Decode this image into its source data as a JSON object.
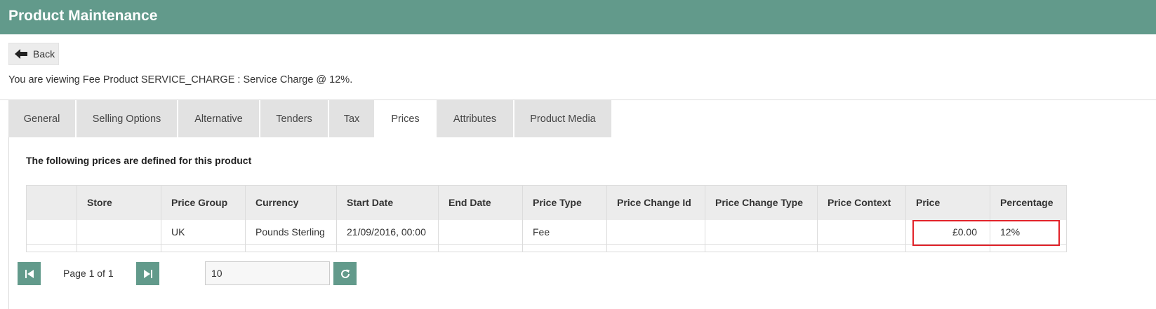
{
  "header": {
    "title": "Product Maintenance"
  },
  "back_button": {
    "label": "Back"
  },
  "viewing_text": "You are viewing Fee Product SERVICE_CHARGE : Service Charge @ 12%.",
  "tabs": [
    {
      "label": "General",
      "active": false
    },
    {
      "label": "Selling Options",
      "active": false
    },
    {
      "label": "Alternative",
      "active": false
    },
    {
      "label": "Tenders",
      "active": false
    },
    {
      "label": "Tax",
      "active": false
    },
    {
      "label": "Prices",
      "active": true
    },
    {
      "label": "Attributes",
      "active": false
    },
    {
      "label": "Product Media",
      "active": false
    }
  ],
  "prices": {
    "title": "The following prices are defined for this product",
    "columns": [
      "",
      "Store",
      "Price Group",
      "Currency",
      "Start Date",
      "End Date",
      "Price Type",
      "Price Change Id",
      "Price Change Type",
      "Price Context",
      "Price",
      "Percentage"
    ],
    "rows": [
      [
        "",
        "",
        "UK",
        "Pounds Sterling",
        "21/09/2016, 00:00",
        "",
        "Fee",
        "",
        "",
        "",
        "£0.00",
        "12%"
      ]
    ]
  },
  "pager": {
    "page_info": "Page 1 of 1",
    "page_size": "10",
    "first_icon": "first-page-icon",
    "last_icon": "last-page-icon",
    "refresh_icon": "refresh-icon"
  },
  "colors": {
    "accent": "#629a8b",
    "highlight": "#e2232a"
  }
}
